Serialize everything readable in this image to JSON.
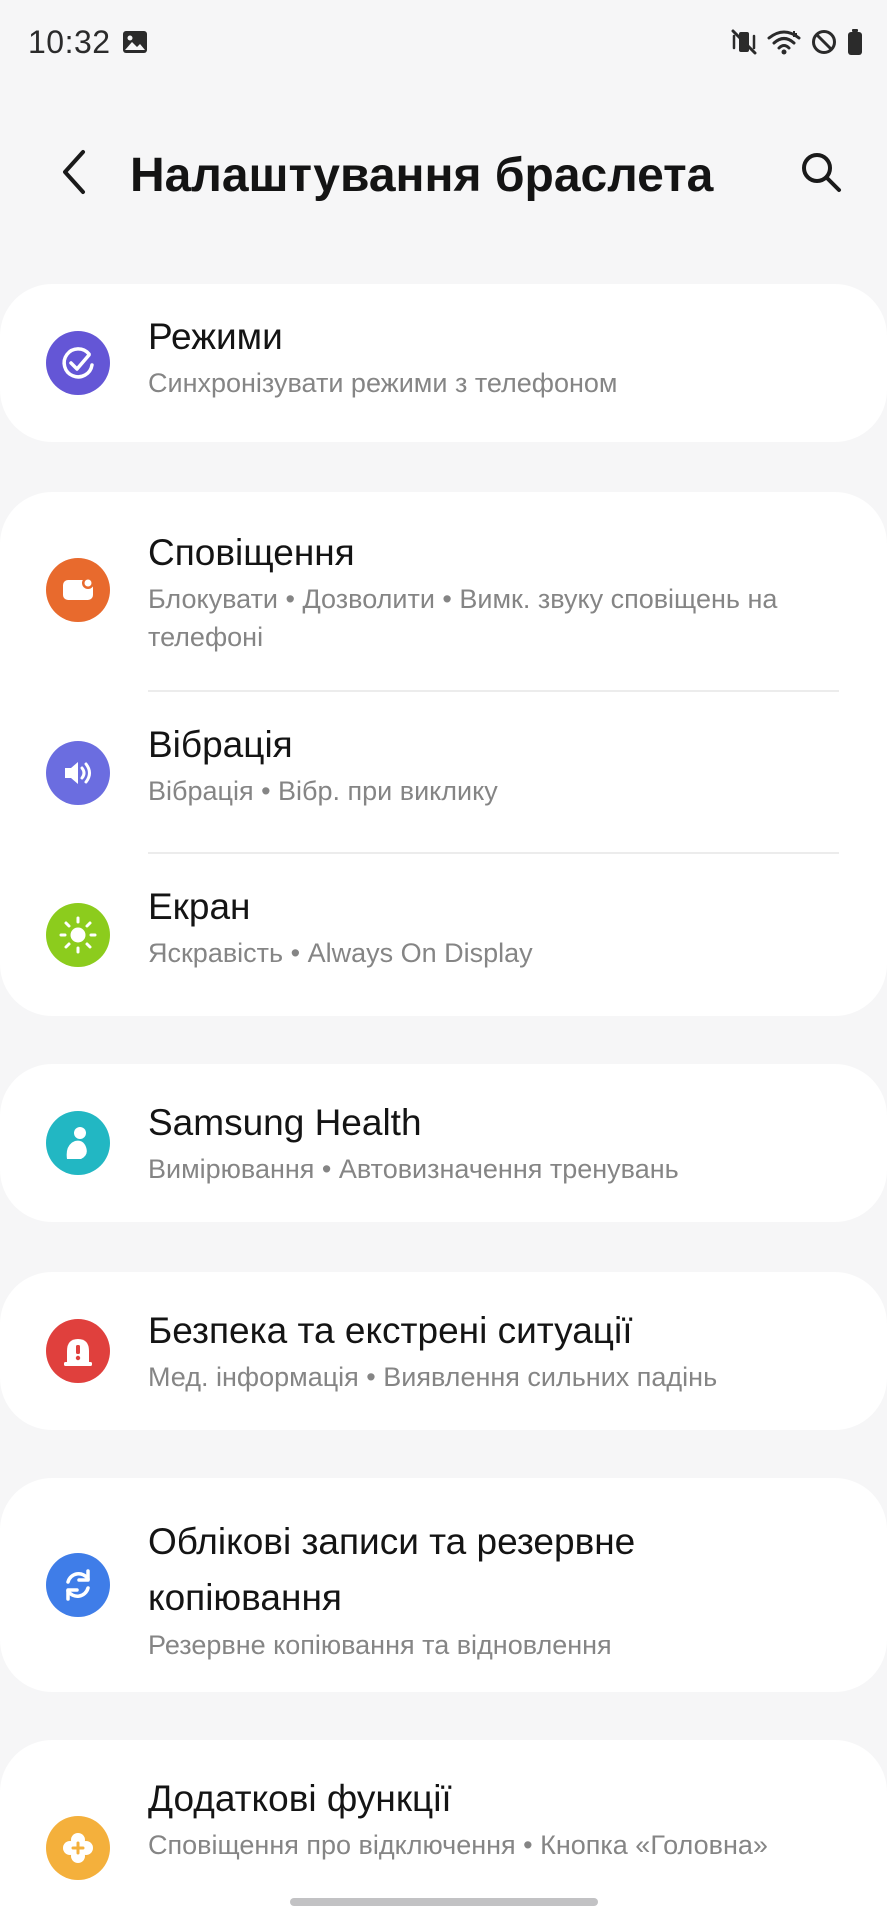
{
  "status_bar": {
    "time": "10:32",
    "left_icons": [
      "gallery-icon"
    ],
    "right_icons": [
      "vibrate-mute-icon",
      "wifi-icon",
      "do-not-disturb-icon",
      "battery-icon"
    ]
  },
  "header": {
    "back_icon": "chevron-left-icon",
    "title": "Налаштування браслета",
    "search_icon": "search-icon"
  },
  "settings": [
    {
      "items": [
        {
          "title": "Режими",
          "subtitle": "Синхронізувати режими з телефоном",
          "icon": "modes-check-icon",
          "icon_color": "#6456d6"
        }
      ]
    },
    {
      "items": [
        {
          "title": "Сповіщення",
          "subtitle": "Блокувати • Дозволити • Вимк. звуку сповіщень на телефоні",
          "icon": "notification-icon",
          "icon_color": "#e86a2d"
        },
        {
          "title": "Вібрація",
          "subtitle": "Вібрація • Вібр. при виклику",
          "icon": "speaker-icon",
          "icon_color": "#6b6de0"
        },
        {
          "title": "Екран",
          "subtitle": "Яскравість • Always On Display",
          "icon": "sun-icon",
          "icon_color": "#8ccc1d"
        }
      ]
    },
    {
      "items": [
        {
          "title": "Samsung Health",
          "subtitle": "Вимірювання • Автовизначення тренувань",
          "icon": "health-person-icon",
          "icon_color": "#22b7c3"
        }
      ]
    },
    {
      "items": [
        {
          "title": "Безпека та екстрені ситуації",
          "subtitle": "Мед. інформація • Виявлення сильних падінь",
          "icon": "alert-icon",
          "icon_color": "#e0403d"
        }
      ]
    },
    {
      "items": [
        {
          "title": "Облікові записи та резервне копіювання",
          "subtitle": "Резервне копіювання та відновлення",
          "icon": "sync-icon",
          "icon_color": "#3f7de8"
        }
      ]
    },
    {
      "items": [
        {
          "title": "Додаткові функції",
          "subtitle": "Сповіщення про відключення • Кнопка «Головна»",
          "icon": "plus-flower-icon",
          "icon_color": "#f4b03c"
        }
      ]
    }
  ]
}
